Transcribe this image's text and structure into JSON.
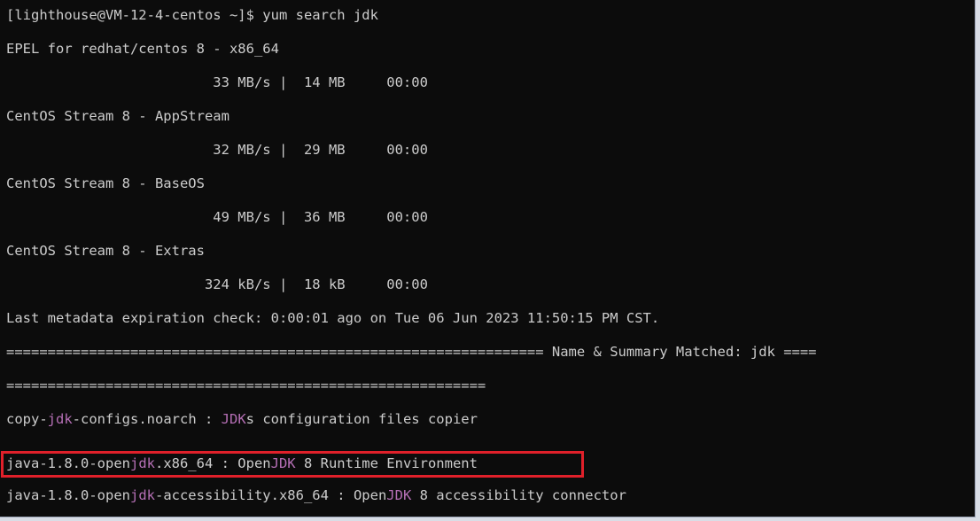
{
  "terminal": {
    "prompt": "[lighthouse@VM-12-4-centos ~]$ yum search jdk",
    "repo_epel": "EPEL for redhat/centos 8 - x86_64",
    "repo_epel_stats": "                         33 MB/s |  14 MB     00:00",
    "repo_appstream": "CentOS Stream 8 - AppStream",
    "repo_appstream_stats": "                         32 MB/s |  29 MB     00:00",
    "repo_baseos": "CentOS Stream 8 - BaseOS",
    "repo_baseos_stats": "                         49 MB/s |  36 MB     00:00",
    "repo_extras": "CentOS Stream 8 - Extras",
    "repo_extras_stats": "                        324 kB/s |  18 kB     00:00",
    "metadata_check": "Last metadata expiration check: 0:00:01 ago on Tue 06 Jun 2023 11:50:15 PM CST.",
    "separator_top": "================================================================= Name & Summary Matched: jdk ====",
    "separator_bottom": "==========================================================",
    "results": [
      {
        "pre": "copy-",
        "match1": "jdk",
        "mid": "-configs.noarch : ",
        "match2": "JDK",
        "post": "s configuration files copier"
      },
      {
        "pre": "java-1.8.0-open",
        "match1": "jdk",
        "mid": ".x86_64 : Open",
        "match2": "JDK",
        "post": " 8 Runtime Environment"
      },
      {
        "pre": "java-1.8.0-open",
        "match1": "jdk",
        "mid": "-accessibility.x86_64 : Open",
        "match2": "JDK",
        "post": " 8 accessibility connector"
      }
    ],
    "colors": {
      "background": "#0c0c0c",
      "text": "#cccccc",
      "match_highlight": "#b56fb5",
      "annotation_box": "#e0202a"
    }
  }
}
